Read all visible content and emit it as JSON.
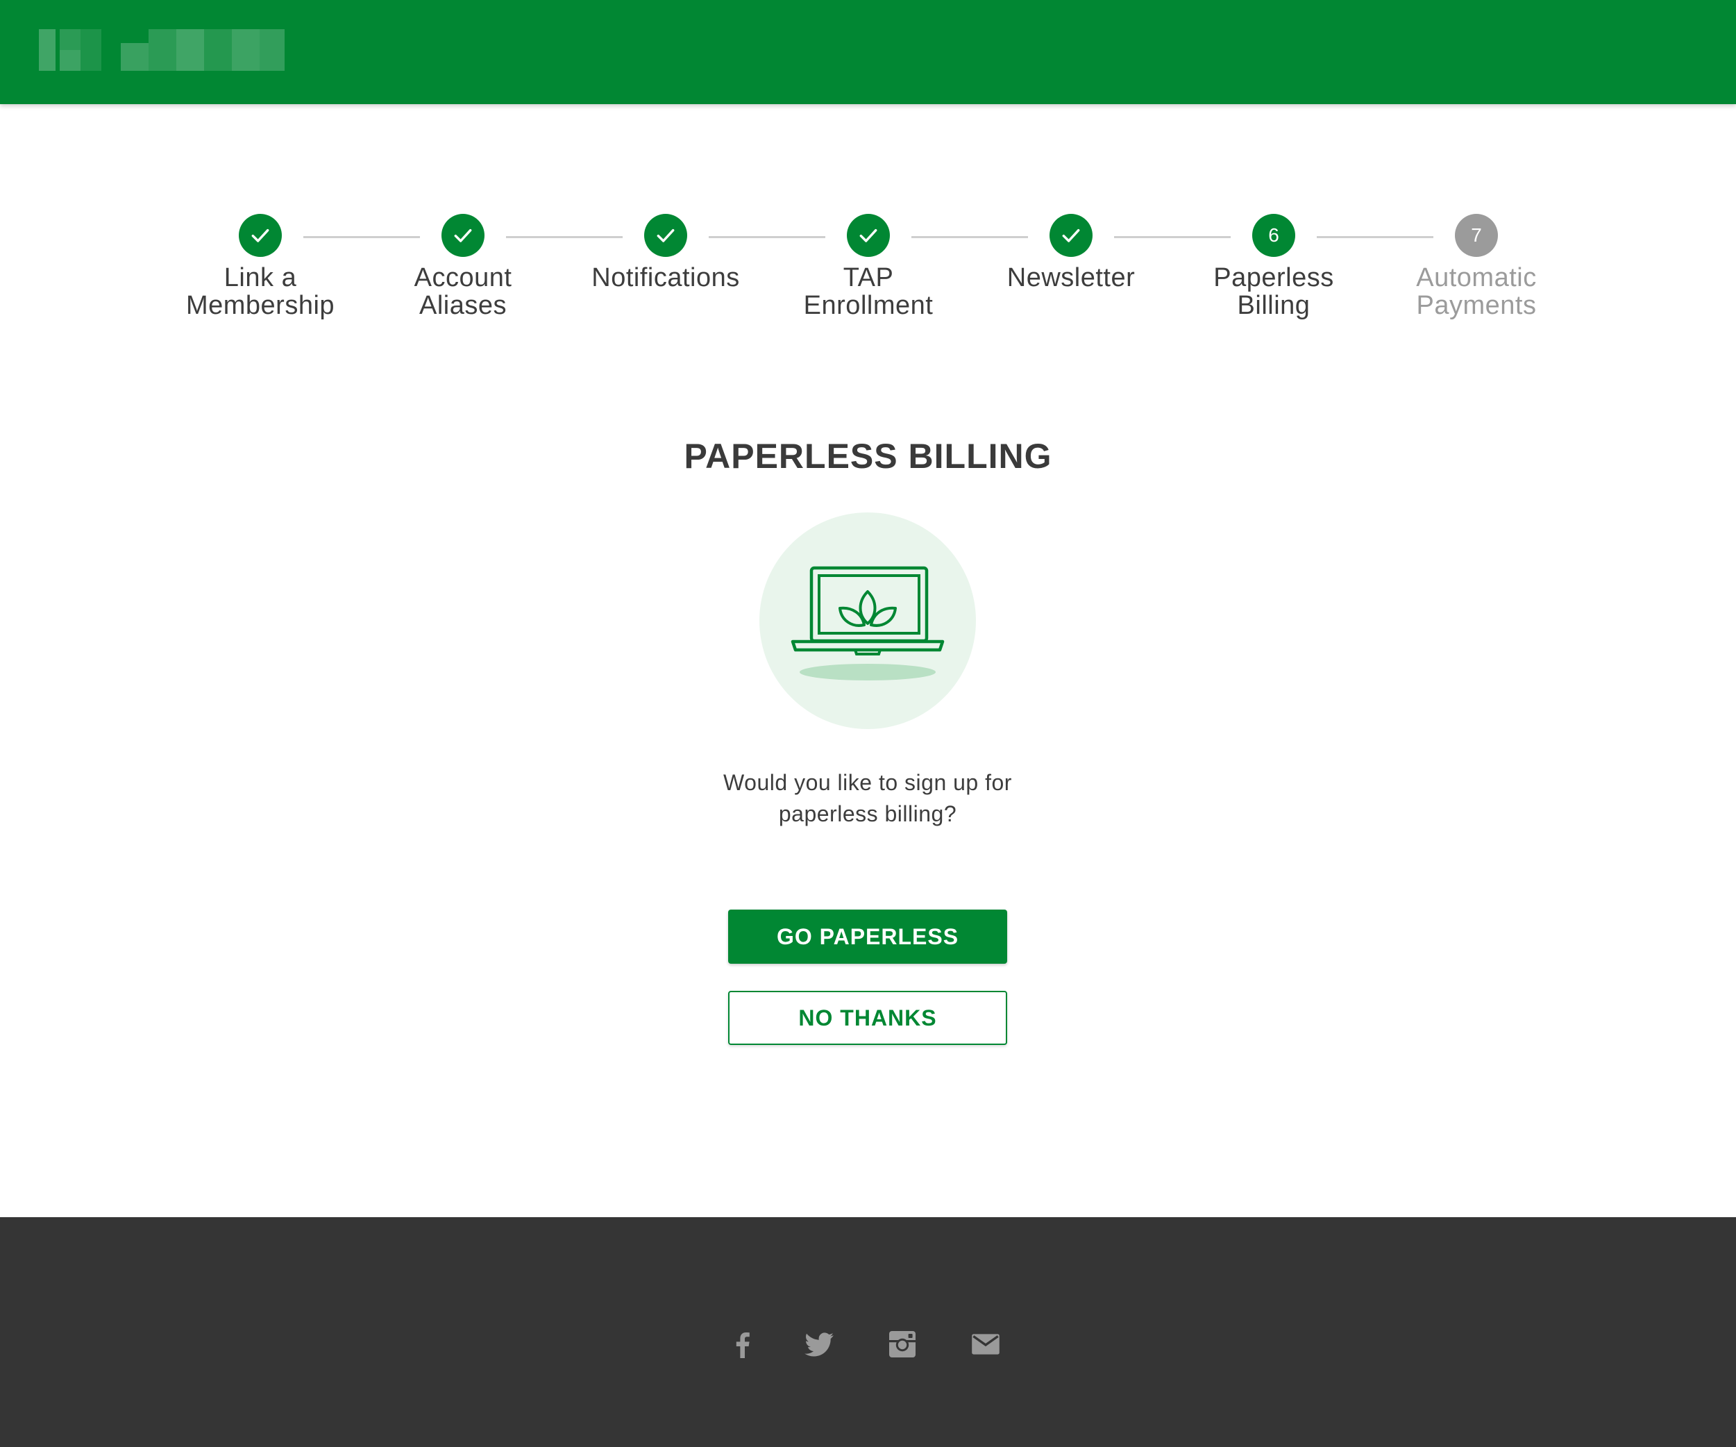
{
  "colors": {
    "brand_green": "#018733",
    "pending_gray": "#9b9b9b",
    "footer_bg": "#353535"
  },
  "stepper": {
    "steps": [
      {
        "label_line1": "Link a",
        "label_line2": "Membership",
        "status": "complete",
        "icon": "check-icon"
      },
      {
        "label_line1": "Account",
        "label_line2": "Aliases",
        "status": "complete",
        "icon": "check-icon"
      },
      {
        "label_line1": "Notifications",
        "label_line2": "",
        "status": "complete",
        "icon": "check-icon"
      },
      {
        "label_line1": "TAP",
        "label_line2": "Enrollment",
        "status": "complete",
        "icon": "check-icon"
      },
      {
        "label_line1": "Newsletter",
        "label_line2": "",
        "status": "complete",
        "icon": "check-icon"
      },
      {
        "label_line1": "Paperless",
        "label_line2": "Billing",
        "status": "current",
        "number": "6"
      },
      {
        "label_line1": "Automatic",
        "label_line2": "Payments",
        "status": "pending",
        "number": "7"
      }
    ]
  },
  "main": {
    "title": "PAPERLESS BILLING",
    "illustration_icon": "laptop-leaves-icon",
    "question_line1": "Would you like to sign up for",
    "question_line2": "paperless billing?",
    "primary_button": "GO PAPERLESS",
    "secondary_button": "NO THANKS"
  },
  "footer": {
    "social_icons": [
      "facebook-icon",
      "twitter-icon",
      "instagram-icon",
      "email-icon"
    ]
  }
}
